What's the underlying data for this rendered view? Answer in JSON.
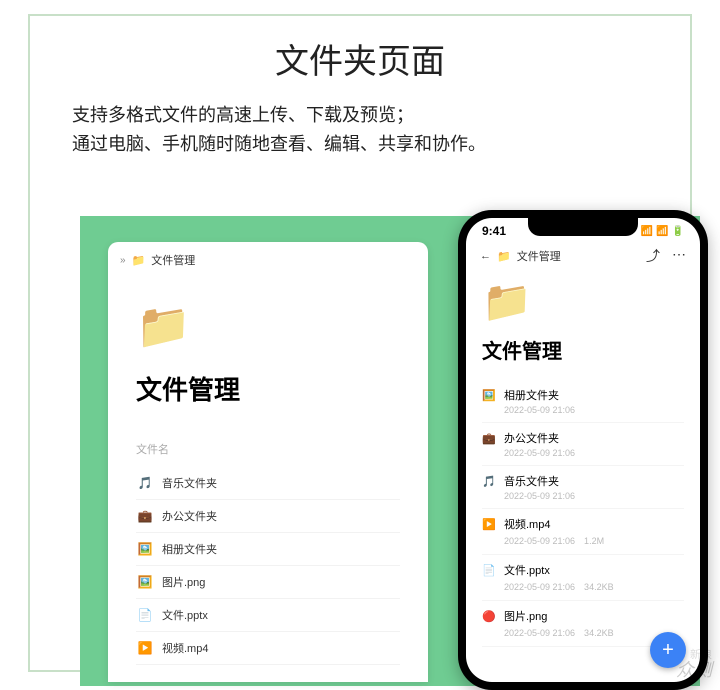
{
  "title": "文件夹页面",
  "desc_l1": "支持多格式文件的高速上传、下载及预览；",
  "desc_l2": "通过电脑、手机随时随地查看、编辑、共享和协作。",
  "desktop": {
    "breadcrumb": "文件管理",
    "heading": "文件管理",
    "section": "文件名",
    "items": [
      {
        "icon": "🎵",
        "name": "音乐文件夹"
      },
      {
        "icon": "💼",
        "name": "办公文件夹"
      },
      {
        "icon": "🖼️",
        "name": "相册文件夹"
      },
      {
        "icon": "🖼️",
        "name": "图片.png"
      },
      {
        "icon": "📄",
        "name": "文件.pptx"
      },
      {
        "icon": "▶️",
        "name": "视频.mp4"
      }
    ]
  },
  "phone": {
    "time": "9:41",
    "breadcrumb": "文件管理",
    "heading": "文件管理",
    "items": [
      {
        "icon": "🖼️",
        "name": "相册文件夹",
        "date": "2022-05-09 21:06",
        "size": ""
      },
      {
        "icon": "💼",
        "name": "办公文件夹",
        "date": "2022-05-09 21:06",
        "size": ""
      },
      {
        "icon": "🎵",
        "name": "音乐文件夹",
        "date": "2022-05-09 21:06",
        "size": ""
      },
      {
        "icon": "▶️",
        "name": "视频.mp4",
        "date": "2022-05-09 21:06",
        "size": "1.2M"
      },
      {
        "icon": "📄",
        "name": "文件.pptx",
        "date": "2022-05-09 21:06",
        "size": "34.2KB"
      },
      {
        "icon": "🔴",
        "name": "图片.png",
        "date": "2022-05-09 21:06",
        "size": "34.2KB"
      }
    ]
  },
  "watermark_s": "新浪",
  "watermark": "众测"
}
